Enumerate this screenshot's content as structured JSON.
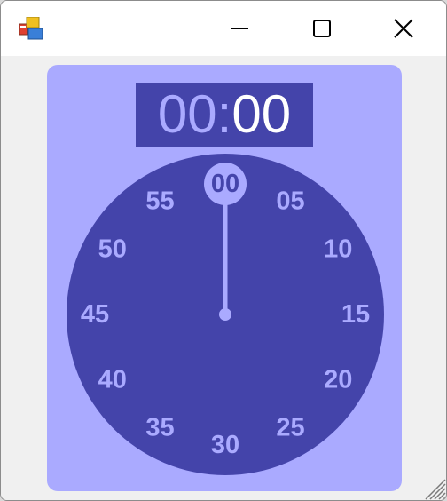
{
  "window": {
    "title": "",
    "controls": [
      "minimize",
      "maximize",
      "close"
    ]
  },
  "timer": {
    "minutes": "00",
    "separator": ":",
    "seconds": "00"
  },
  "dial": {
    "labels": [
      "00",
      "05",
      "10",
      "15",
      "20",
      "25",
      "30",
      "35",
      "40",
      "45",
      "50",
      "55"
    ],
    "hand_position_seconds": 0,
    "colors": {
      "panel": "#aaaaff",
      "face": "#4444aa",
      "label": "#aaaaff",
      "hand": "#aaaaff"
    }
  }
}
